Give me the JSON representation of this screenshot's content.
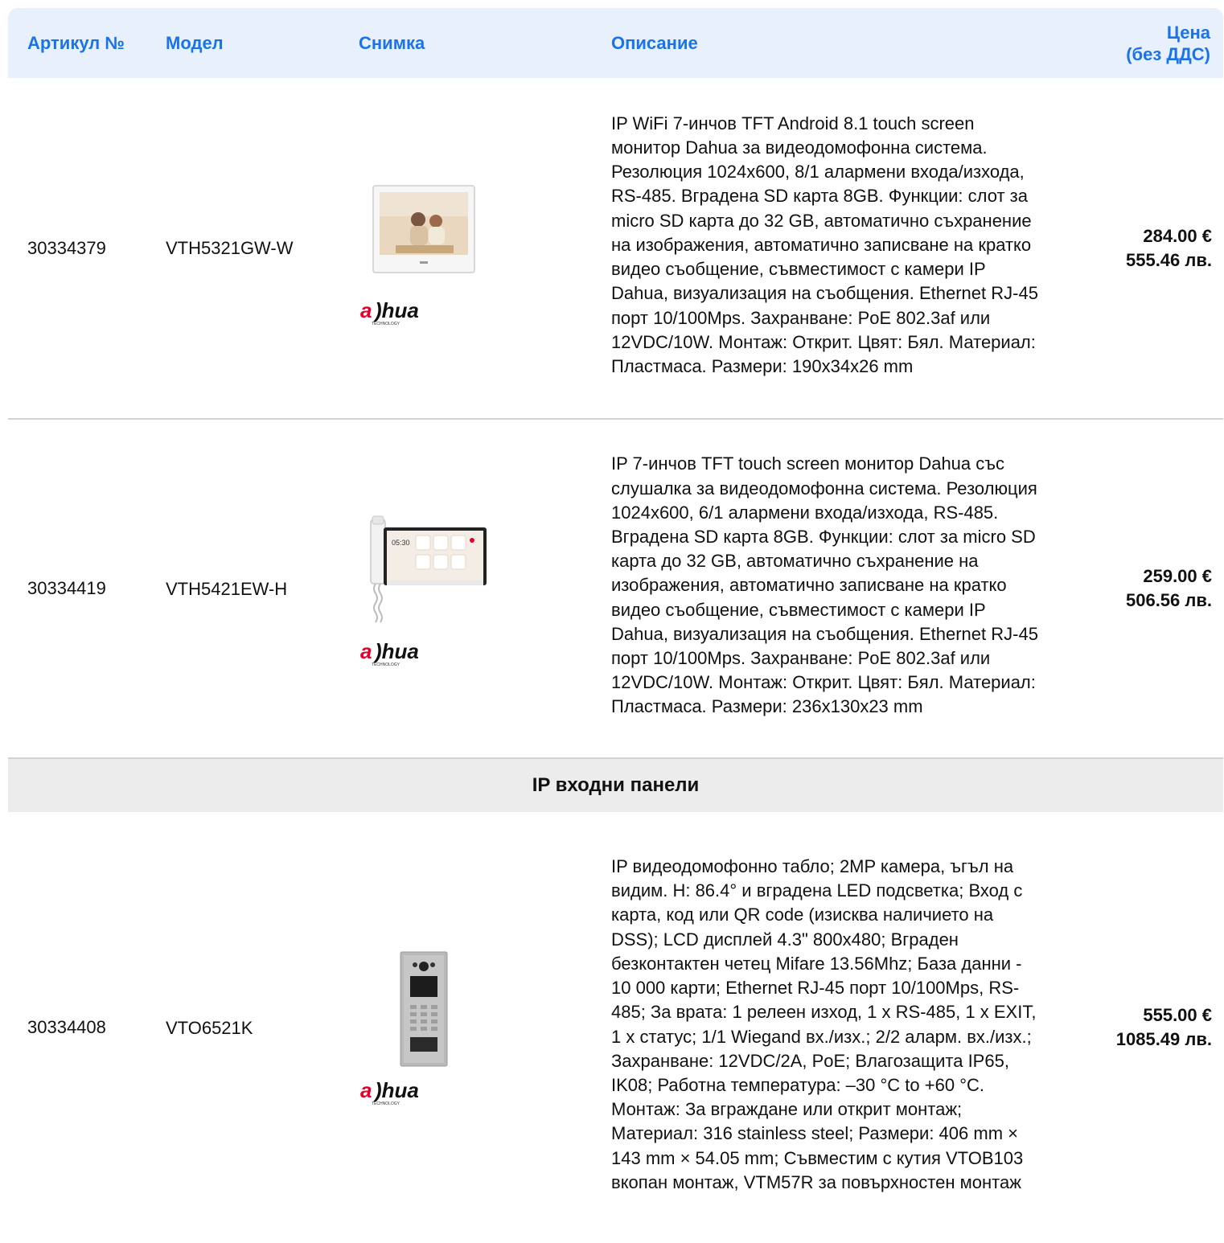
{
  "table": {
    "headers": {
      "article": "Артикул №",
      "model": "Модел",
      "image": "Снимка",
      "description": "Описание",
      "price_line1": "Цена",
      "price_line2": "(без ДДС)"
    },
    "rows": [
      {
        "article": "30334379",
        "model": "VTH5321GW-W",
        "description": "IP WiFi 7-инчов TFT Android 8.1 touch screen монитор Dahua за видеодомофонна система. Резолюция 1024x600, 8/1 алармени входа/изхода, RS-485. Вградена SD карта 8GB. Функции: слот за micro SD карта до 32 GB, автоматично съхранение на изображения, автоматично записване на кратко видео съобщение, съвместимост с камери IP Dahua, визуализация на съобщения. Ethernet RJ-45 порт 10/100Mps. Захранване: PoE 802.3af или 12VDC/10W. Монтаж: Открит. Цвят: Бял. Материал: Пластмаса. Размери: 190x34x26 mm",
        "price_eur": "284.00 €",
        "price_bgn": "555.46 лв."
      },
      {
        "article": "30334419",
        "model": "VTH5421EW-H",
        "description": "IP 7-инчов TFT touch screen монитор Dahua със слушалка за видеодомофонна система. Резолюция 1024x600, 6/1 алармени входа/изхода, RS-485. Вградена SD карта 8GB. Функции: слот за micro SD карта до 32 GB, автоматично съхранение на изображения, автоматично записване на кратко видео съобщение, съвместимост с камери IP Dahua, визуализация на съобщения. Ethernet RJ-45 порт 10/100Mps. Захранване: PoE 802.3af или 12VDC/10W. Монтаж: Открит. Цвят: Бял. Материал: Пластмаса. Размери: 236x130x23 mm",
        "price_eur": "259.00 €",
        "price_bgn": "506.56 лв."
      }
    ],
    "section_title": "IP входни панели",
    "section_rows": [
      {
        "article": "30334408",
        "model": "VTO6521K",
        "description": "IP видеодомофонно табло; 2MP камера, ъгъл на видим. H: 86.4° и вградена LED подсветка; Вход с карта, код или QR code (изисква наличието на DSS); LCD дисплей 4.3\" 800x480; Вграден безконтактен четец Mifare 13.56Mhz; База данни - 10 000 карти; Ethernet RJ-45 порт 10/100Mps, RS-485; За врата: 1 релеен изход, 1 x RS-485, 1 x EXIT, 1 x статус; 1/1 Wiegand вх./изх.; 2/2 аларм. вх./изх.; Захранване: 12VDC/2A, PoE; Влагозащита IP65, IK08; Работна температура: –30 °C to +60 °C. Монтаж: За вграждане или открит монтаж; Материал: 316 stainless steel; Размери: 406 mm × 143 mm × 54.05 mm; Съвместим с кутия VTOB103 вкопан монтаж, VTM57R за повърхностен монтаж",
        "price_eur": "555.00 €",
        "price_bgn": "1085.49 лв."
      }
    ],
    "brand": {
      "logo_text": "alhua",
      "logo_subtext": "TECHNOLOGY",
      "logo_color": "#e4002b"
    }
  }
}
